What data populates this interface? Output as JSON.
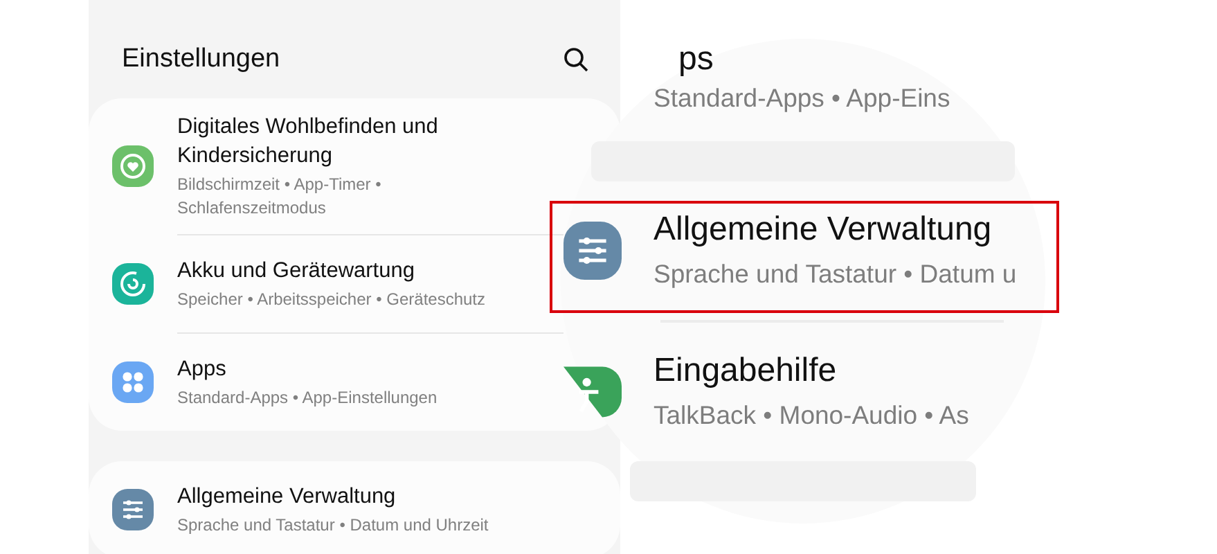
{
  "header": {
    "title": "Einstellungen"
  },
  "groups": [
    {
      "items": [
        {
          "kind": "wellbeing",
          "title": "Digitales Wohlbefinden und Kindersicherung",
          "subtitle": "Bildschirmzeit • App-Timer • Schlafenszeitmodus"
        },
        {
          "kind": "battery",
          "title": "Akku und Gerätewartung",
          "subtitle": "Speicher • Arbeitsspeicher • Geräteschutz"
        },
        {
          "kind": "apps",
          "title": "Apps",
          "subtitle": "Standard-Apps • App-Einstellungen"
        }
      ]
    },
    {
      "items": [
        {
          "kind": "sliders",
          "title": "Allgemeine Verwaltung",
          "subtitle": "Sprache und Tastatur • Datum und Uhrzeit"
        }
      ]
    }
  ],
  "magnifier": {
    "groups": [
      {
        "items": [
          {
            "kind": "none",
            "title": "ps",
            "subtitle": "Standard-Apps • App-Eins"
          }
        ]
      },
      {
        "items": [
          {
            "kind": "sliders",
            "title": "Allgemeine Verwaltung",
            "subtitle": "Sprache und Tastatur • Datum u"
          },
          {
            "kind": "accessibility",
            "title": "Eingabehilfe",
            "subtitle": "TalkBack • Mono-Audio • As"
          }
        ]
      }
    ]
  }
}
